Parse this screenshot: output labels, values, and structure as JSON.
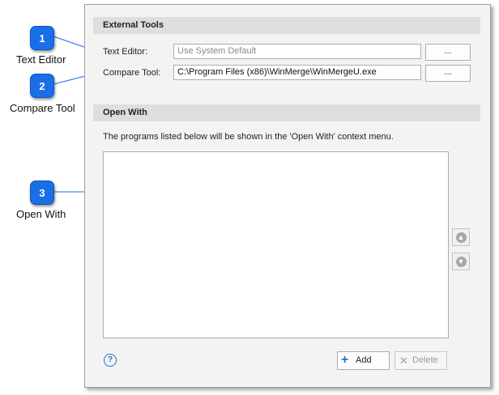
{
  "external_tools": {
    "header": "External Tools",
    "text_editor_label": "Text Editor:",
    "text_editor_placeholder": "Use System Default",
    "text_editor_browse": "...",
    "compare_tool_label": "Compare Tool:",
    "compare_tool_value": "C:\\Program Files (x86)\\WinMerge\\WinMergeU.exe",
    "compare_tool_browse": "..."
  },
  "open_with": {
    "header": "Open With",
    "description": "The programs listed below will be shown in the 'Open With' context menu.",
    "items": [],
    "add_label": "Add",
    "delete_label": "Delete"
  },
  "callouts": [
    {
      "number": "1",
      "label": "Text Editor"
    },
    {
      "number": "2",
      "label": "Compare Tool"
    },
    {
      "number": "3",
      "label": "Open With"
    }
  ],
  "colors": {
    "callout_badge": "#1a6fe8",
    "section_header_bg": "#dedede",
    "panel_bg": "#f3f3f3",
    "help_icon": "#1e73d6",
    "add_plus": "#1e73d6"
  }
}
